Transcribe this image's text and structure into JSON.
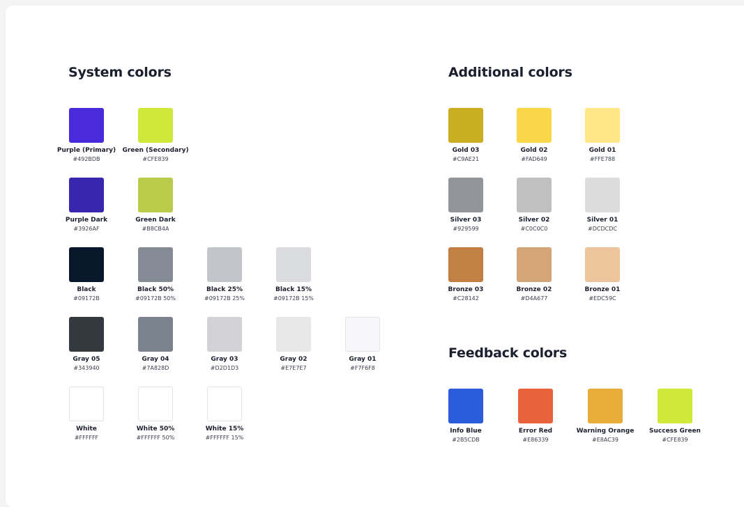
{
  "system": {
    "title": "System colors",
    "rows": [
      [
        {
          "name": "Purple (Primary)",
          "hex": "#492BDB",
          "color": "#492BDB"
        },
        {
          "name": "Green (Secondary)",
          "hex": "#CFE839",
          "color": "#CFE839"
        }
      ],
      [
        {
          "name": "Purple Dark",
          "hex": "#3926AF",
          "color": "#3926AF"
        },
        {
          "name": "Green Dark",
          "hex": "#B8CB4A",
          "color": "#B8CB4A"
        }
      ],
      [
        {
          "name": "Black",
          "hex": "#09172B",
          "color": "#09172B"
        },
        {
          "name": "Black 50%",
          "hex": "#09172B 50%",
          "color": "#848B95"
        },
        {
          "name": "Black 25%",
          "hex": "#09172B 25%",
          "color": "#C2C5CA"
        },
        {
          "name": "Black 15%",
          "hex": "#09172B 15%",
          "color": "#DADCDF"
        }
      ],
      [
        {
          "name": "Gray 05",
          "hex": "#343940",
          "color": "#343940"
        },
        {
          "name": "Gray 04",
          "hex": "#7A828D",
          "color": "#7A828D"
        },
        {
          "name": "Gray 03",
          "hex": "#D2D1D3",
          "color": "#D2D1D3"
        },
        {
          "name": "Gray 02",
          "hex": "#E7E7E7",
          "color": "#E7E7E7"
        },
        {
          "name": "Gray 01",
          "hex": "#F7F6F8",
          "color": "#F7F6F8"
        }
      ],
      [
        {
          "name": "White",
          "hex": "#FFFFFF",
          "color": "#FFFFFF"
        },
        {
          "name": "White 50%",
          "hex": "#FFFFFF 50%",
          "color": "#FFFFFF"
        },
        {
          "name": "White 15%",
          "hex": "#FFFFFF 15%",
          "color": "#FFFFFF"
        }
      ]
    ]
  },
  "additional": {
    "title": "Additional colors",
    "rows": [
      [
        {
          "name": "Gold 03",
          "hex": "#C9AE21",
          "color": "#C9AE21"
        },
        {
          "name": "Gold 02",
          "hex": "#FAD649",
          "color": "#FAD649"
        },
        {
          "name": "Gold 01",
          "hex": "#FFE788",
          "color": "#FFE788"
        }
      ],
      [
        {
          "name": "Silver 03",
          "hex": "#929599",
          "color": "#929599"
        },
        {
          "name": "Silver 02",
          "hex": "#C0C0C0",
          "color": "#C0C0C0"
        },
        {
          "name": "Silver 01",
          "hex": "#DCDCDC",
          "color": "#DCDCDC"
        }
      ],
      [
        {
          "name": "Bronze 03",
          "hex": "#C28142",
          "color": "#C28142"
        },
        {
          "name": "Bronze 02",
          "hex": "#D4A677",
          "color": "#D4A677"
        },
        {
          "name": "Bronze 01",
          "hex": "#EDC59C",
          "color": "#EDC59C"
        }
      ]
    ]
  },
  "feedback": {
    "title": "Feedback colors",
    "rows": [
      [
        {
          "name": "Info Blue",
          "hex": "#2B5CDB",
          "color": "#2B5CDB"
        },
        {
          "name": "Error Red",
          "hex": "#E86339",
          "color": "#E86339"
        },
        {
          "name": "Warning Orange",
          "hex": "#E8AC39",
          "color": "#E8AC39"
        },
        {
          "name": "Success Green",
          "hex": "#CFE839",
          "color": "#CFE839"
        }
      ]
    ]
  }
}
